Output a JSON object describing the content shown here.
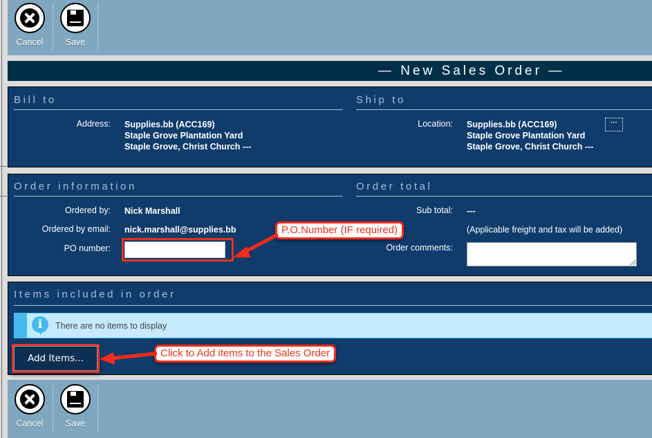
{
  "toolbar": {
    "cancel": {
      "label": "Cancel",
      "icon": "cancel-icon"
    },
    "save": {
      "label": "Save",
      "icon": "floppy-disk-icon"
    }
  },
  "page_title": "— New Sales Order —",
  "bill_to": {
    "title": "Bill to",
    "address_label": "Address:",
    "address_lines": [
      "Supplies.bb (ACC169)",
      "Staple Grove Plantation Yard",
      "Staple Grove, Christ Church ---"
    ]
  },
  "ship_to": {
    "title": "Ship to",
    "location_label": "Location:",
    "location_lines": [
      "Supplies.bb (ACC169)",
      "Staple Grove Plantation Yard",
      "Staple Grove, Christ Church ---"
    ],
    "browse_button": "···"
  },
  "order_info": {
    "title": "Order information",
    "ordered_by_label": "Ordered by:",
    "ordered_by": "Nick Marshall",
    "email_label": "Ordered by email:",
    "email": "nick.marshall@supplies.bb",
    "po_label": "PO number:",
    "po_value": "",
    "po_placeholder": ""
  },
  "order_total": {
    "title": "Order total",
    "subtotal_label": "Sub total:",
    "subtotal": "---",
    "note": "(Applicable freight and tax will be added)",
    "comments_label": "Order comments:",
    "comments_value": ""
  },
  "items": {
    "title": "Items included in order",
    "empty_message": "There are no items to display",
    "add_button": "Add Items..."
  },
  "annotations": {
    "po_callout": "P.O.Number (IF required)",
    "add_callout": "Click to Add items to the Sales Order",
    "callout_color": "#e8321e"
  },
  "colors": {
    "toolbar_bg": "#7fa8c0",
    "title_bg": "#003049",
    "panel_bg": "#0f3c6b",
    "info_bg": "#c4eafc",
    "info_accent": "#45b9f0"
  }
}
